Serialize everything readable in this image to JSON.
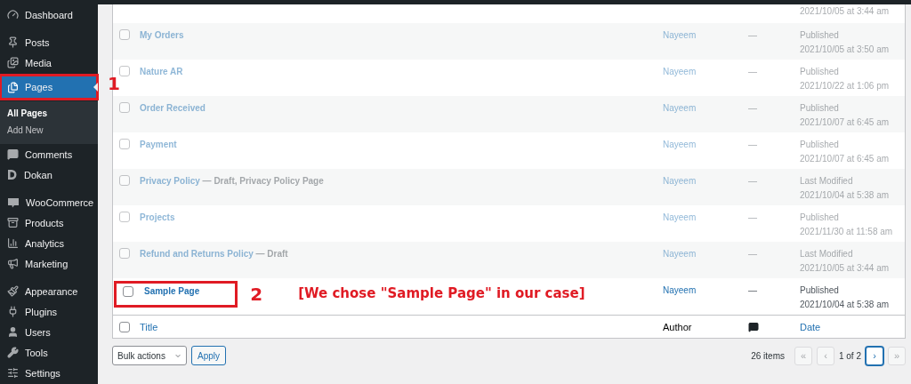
{
  "sidebar": {
    "items": [
      {
        "label": "Dashboard",
        "selected": false,
        "annotated": false
      },
      {
        "label": "Posts",
        "selected": false,
        "annotated": false
      },
      {
        "label": "Media",
        "selected": false,
        "annotated": false
      },
      {
        "label": "Pages",
        "selected": true,
        "annotated": true,
        "children": [
          {
            "label": "All Pages",
            "selected": true
          },
          {
            "label": "Add New",
            "selected": false
          }
        ]
      },
      {
        "label": "Comments",
        "selected": false,
        "annotated": false
      },
      {
        "label": "Dokan",
        "selected": false,
        "annotated": false
      },
      {
        "label": "WooCommerce",
        "selected": false,
        "annotated": false
      },
      {
        "label": "Products",
        "selected": false,
        "annotated": false
      },
      {
        "label": "Analytics",
        "selected": false,
        "annotated": false
      },
      {
        "label": "Marketing",
        "selected": false,
        "annotated": false
      },
      {
        "label": "Appearance",
        "selected": false,
        "annotated": false
      },
      {
        "label": "Plugins",
        "selected": false,
        "annotated": false
      },
      {
        "label": "Users",
        "selected": false,
        "annotated": false
      },
      {
        "label": "Tools",
        "selected": false,
        "annotated": false
      },
      {
        "label": "Settings",
        "selected": false,
        "annotated": false
      }
    ]
  },
  "menu_callout": {
    "number": "1"
  },
  "table": {
    "partial_row": {
      "date": "2021/10/05 at 3:44 am"
    },
    "rows": [
      {
        "title": "My Orders",
        "author": "Nayeem",
        "comments": "—",
        "status": "Published",
        "date": "2021/10/05 at 3:50 am",
        "dimmed": true,
        "annotated": false,
        "checked": false
      },
      {
        "title": "Nature AR",
        "author": "Nayeem",
        "comments": "—",
        "status": "Published",
        "date": "2021/10/22 at 1:06 pm",
        "dimmed": true,
        "annotated": false,
        "checked": false
      },
      {
        "title": "Order Received",
        "author": "Nayeem",
        "comments": "—",
        "status": "Published",
        "date": "2021/10/07 at 6:45 am",
        "dimmed": true,
        "annotated": false,
        "checked": false
      },
      {
        "title": "Payment",
        "author": "Nayeem",
        "comments": "—",
        "status": "Published",
        "date": "2021/10/07 at 6:45 am",
        "dimmed": true,
        "annotated": false,
        "checked": false
      },
      {
        "title": "Privacy Policy",
        "state": "— Draft, Privacy Policy Page",
        "author": "Nayeem",
        "comments": "—",
        "status": "Last Modified",
        "date": "2021/10/04 at 5:38 am",
        "dimmed": true,
        "annotated": false,
        "checked": false
      },
      {
        "title": "Projects",
        "author": "Nayeem",
        "comments": "—",
        "status": "Published",
        "date": "2021/11/30 at 11:58 am",
        "dimmed": true,
        "annotated": false,
        "checked": false
      },
      {
        "title": "Refund and Returns Policy",
        "state": "— Draft",
        "author": "Nayeem",
        "comments": "—",
        "status": "Last Modified",
        "date": "2021/10/05 at 3:44 am",
        "dimmed": true,
        "annotated": false,
        "checked": false
      },
      {
        "title": "Sample Page",
        "author": "Nayeem",
        "comments": "—",
        "status": "Published",
        "date": "2021/10/04 at 5:38 am",
        "dimmed": false,
        "annotated": true,
        "checked": false,
        "callout": {
          "number": "2",
          "note": "[We chose \"Sample Page\" in our case]"
        }
      }
    ],
    "footer": {
      "checked": false,
      "title": "Title",
      "author": "Author",
      "date": "Date"
    }
  },
  "bulk_actions": {
    "value": "Bulk actions",
    "apply": "Apply"
  },
  "pagination": {
    "count": "26 items",
    "page": "1 of 2",
    "buttons": [
      {
        "label": "«",
        "disabled": true,
        "focused": false
      },
      {
        "label": "‹",
        "disabled": true,
        "focused": false
      },
      {
        "label": "›",
        "disabled": false,
        "focused": true
      },
      {
        "label": "»",
        "disabled": true,
        "focused": false
      }
    ]
  }
}
